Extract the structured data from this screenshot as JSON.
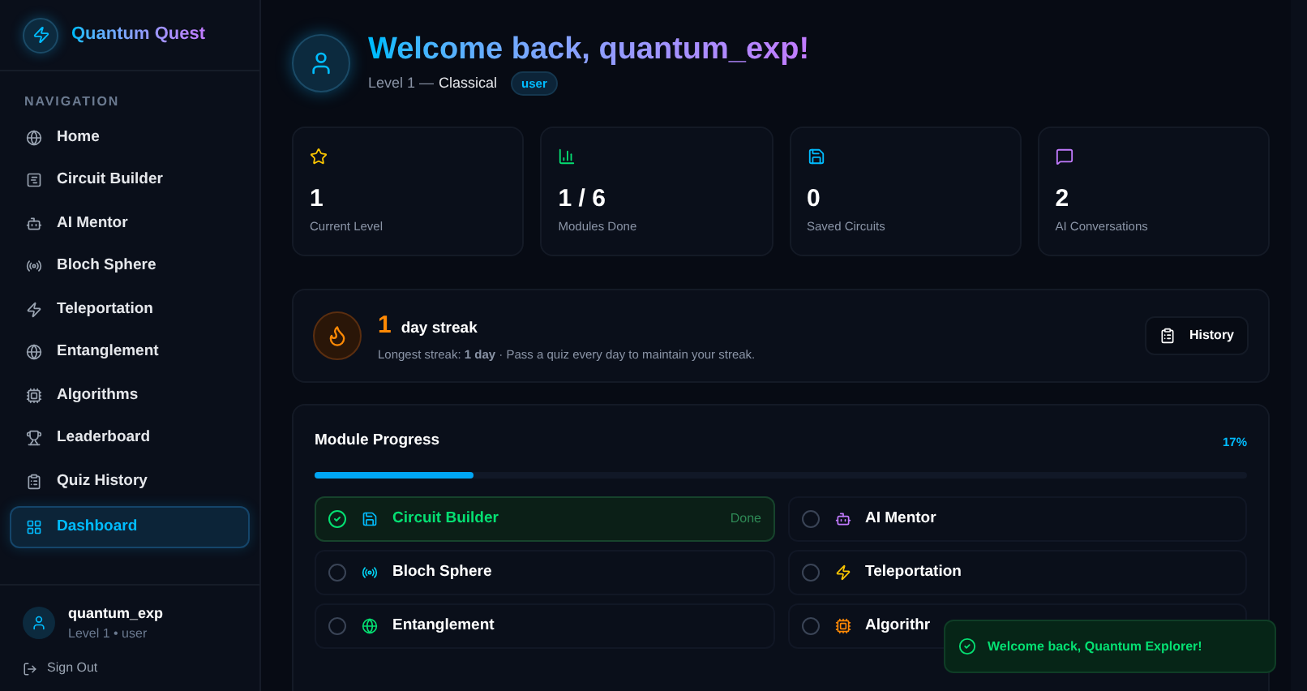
{
  "brand": {
    "name": "Quantum Quest"
  },
  "sidebar": {
    "heading": "NAVIGATION",
    "items": [
      {
        "label": "Home",
        "selected": false
      },
      {
        "label": "Circuit Builder",
        "selected": false
      },
      {
        "label": "AI Mentor",
        "selected": false
      },
      {
        "label": "Bloch Sphere",
        "selected": false
      },
      {
        "label": "Teleportation",
        "selected": false
      },
      {
        "label": "Entanglement",
        "selected": false
      },
      {
        "label": "Algorithms",
        "selected": false
      },
      {
        "label": "Leaderboard",
        "selected": false
      },
      {
        "label": "Quiz History",
        "selected": false
      },
      {
        "label": "Dashboard",
        "selected": true
      }
    ]
  },
  "user": {
    "name": "quantum_exp",
    "meta": "Level 1 • user",
    "sign_out": "Sign Out"
  },
  "header": {
    "greeting": "Welcome back, quantum_exp!",
    "level": "Level 1 —",
    "rank": "Classical",
    "role": "user"
  },
  "stats": [
    {
      "value": "1",
      "label": "Current Level"
    },
    {
      "value": "1 / 6",
      "label": "Modules Done"
    },
    {
      "value": "0",
      "label": "Saved Circuits"
    },
    {
      "value": "2",
      "label": "AI Conversations"
    }
  ],
  "streak": {
    "count": "1",
    "unit": "day streak",
    "note": "Longest streak: **1 day** · Pass a quiz every day to maintain your streak.",
    "button": "History"
  },
  "progress": {
    "title": "Module Progress",
    "percent": "17%",
    "level": 0.17,
    "done_label": "Done",
    "modules": [
      {
        "label": "Circuit Builder",
        "checked": true
      },
      {
        "label": "AI Mentor",
        "checked": false
      },
      {
        "label": "Bloch Sphere",
        "checked": false
      },
      {
        "label": "Teleportation",
        "checked": false
      },
      {
        "label": "Entanglement",
        "checked": false
      },
      {
        "label": "Algorithr",
        "checked": false
      }
    ]
  },
  "toast": {
    "message": "Welcome back, Quantum Explorer!"
  }
}
